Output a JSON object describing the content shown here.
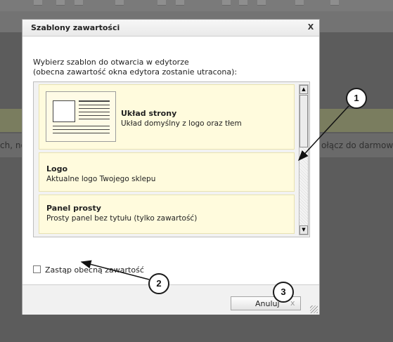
{
  "background": {
    "left_text": "ch, no",
    "right_text": "ołącz do darmoweg"
  },
  "dialog": {
    "title": "Szablony zawartości",
    "close_label": "X",
    "intro_line1": "Wybierz szablon do otwarcia w edytorze",
    "intro_line2": "(obecna zawartość okna edytora zostanie utracona):",
    "templates": [
      {
        "title": "Układ strony",
        "description": "Układ domyślny z logo oraz tłem"
      },
      {
        "title": "Logo",
        "description": "Aktualne logo Twojego sklepu"
      },
      {
        "title": "Panel prosty",
        "description": "Prosty panel bez tytułu (tylko zawartość)"
      }
    ],
    "replace_checkbox_label": "Zastąp obecną zawartość",
    "replace_checked": false,
    "cancel_label": "Anuluj",
    "cancel_icon": "x"
  },
  "annotations": [
    "1",
    "2",
    "3"
  ],
  "colors": {
    "template_bg": "#fffbdd",
    "overlay": "#5c5c5c"
  }
}
